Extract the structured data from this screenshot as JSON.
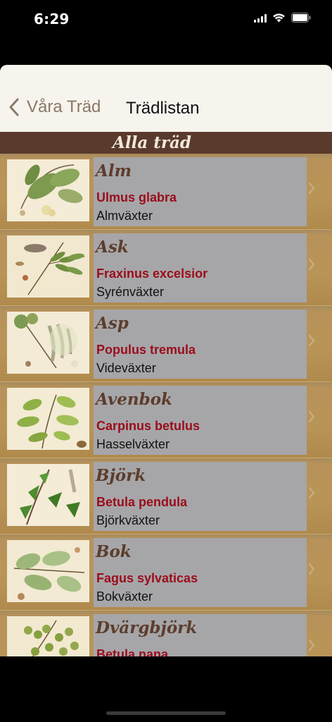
{
  "status_bar": {
    "time": "6:29"
  },
  "nav": {
    "back_label": "Våra Träd",
    "title": "Trädlistan"
  },
  "section": {
    "title": "Alla träd"
  },
  "trees": [
    {
      "name": "Alm",
      "latin": "Ulmus glabra",
      "family": "Almväxter",
      "leaf_color": "#7d9a4f"
    },
    {
      "name": "Ask",
      "latin": "Fraxinus excelsior",
      "family": "Syrénväxter",
      "leaf_color": "#6f8f3e"
    },
    {
      "name": "Asp",
      "latin": "Populus tremula",
      "family": "Videväxter",
      "leaf_color": "#8ea25a"
    },
    {
      "name": "Avenbok",
      "latin": "Carpinus betulus",
      "family": "Hasselväxter",
      "leaf_color": "#8fb045"
    },
    {
      "name": "Björk",
      "latin": "Betula pendula",
      "family": "Björkväxter",
      "leaf_color": "#4e8a2e"
    },
    {
      "name": "Bok",
      "latin": "Fagus sylvaticas",
      "family": "Bokväxter",
      "leaf_color": "#9db77a"
    },
    {
      "name": "Dvärgbjörk",
      "latin": "Betula nana",
      "family": "",
      "leaf_color": "#93a84c"
    }
  ],
  "colors": {
    "tree_name": "#5c3d2c",
    "latin_name": "#9b0d1a",
    "section_bg": "#5a3a2c",
    "card_bg": "#a6a6a9",
    "row_bg": "#b89457"
  }
}
